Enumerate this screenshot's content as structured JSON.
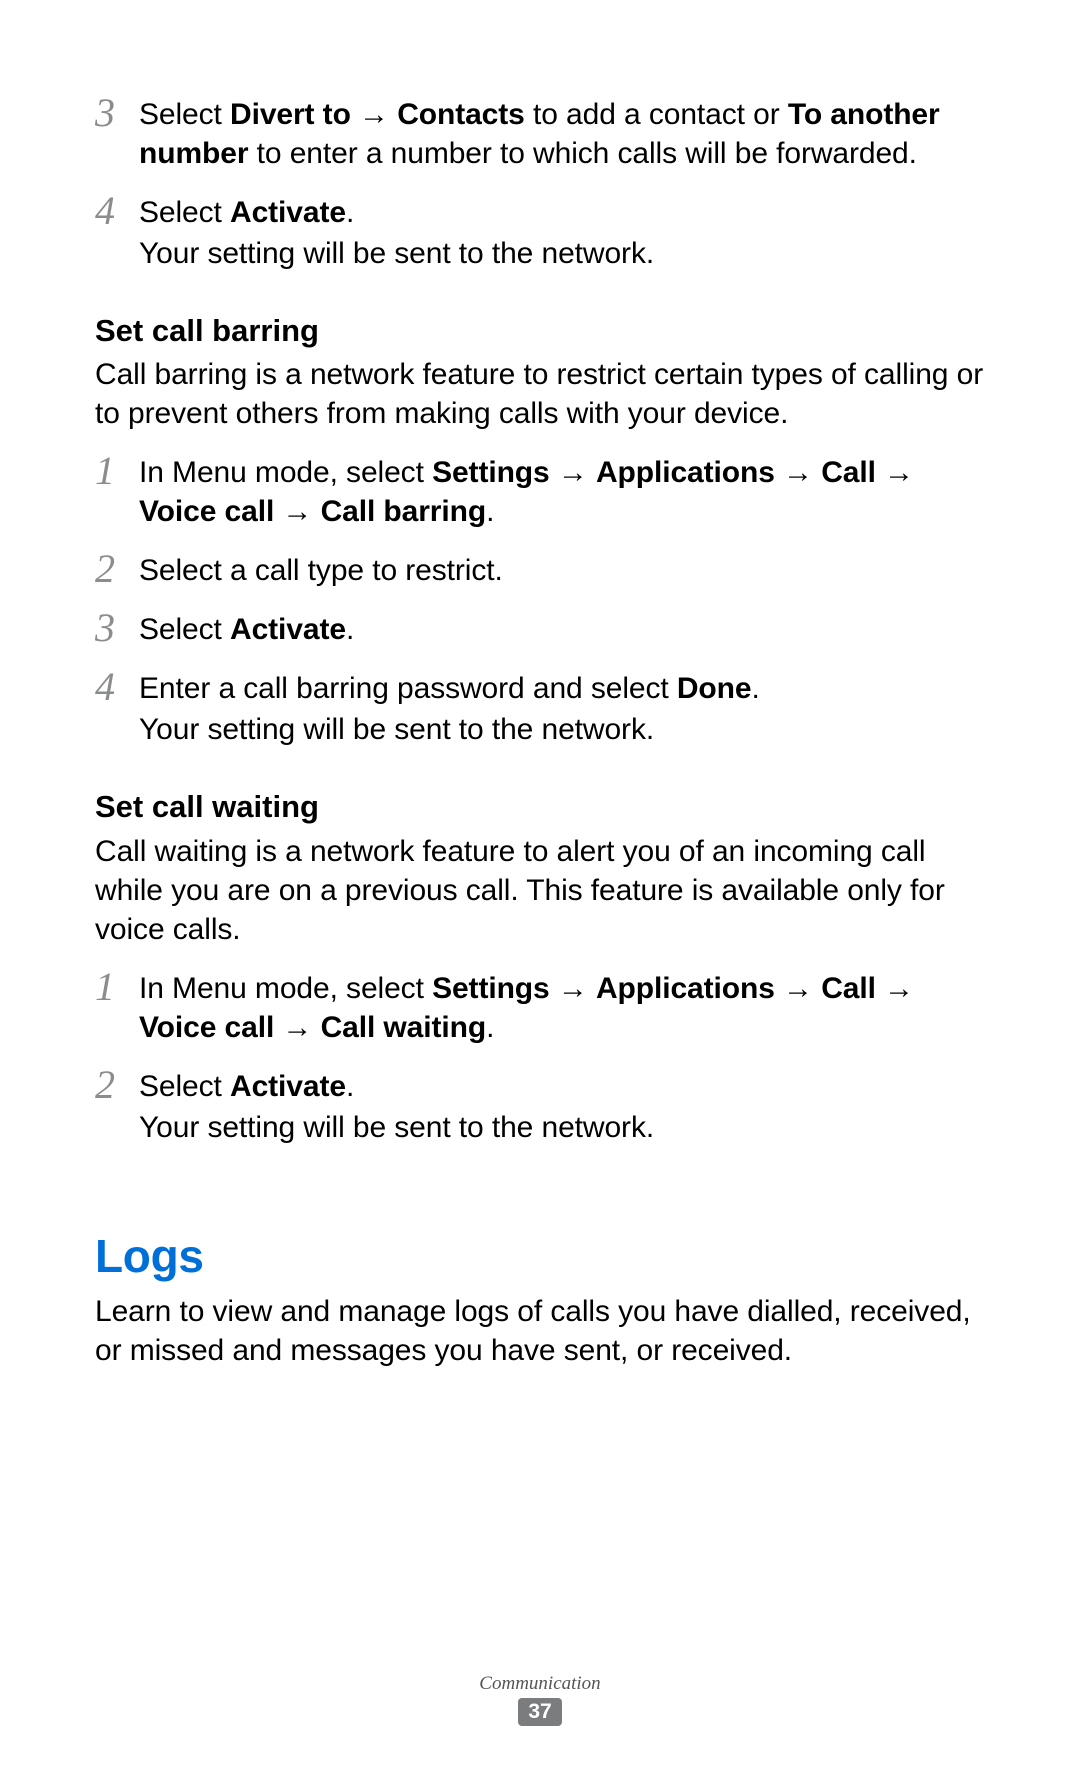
{
  "steps_top": [
    {
      "num": "3",
      "lines": [
        "Select <b>Divert to</b> → <b>Contacts</b> to add a contact or <b>To another number</b> to enter a number to which calls will be forwarded."
      ]
    },
    {
      "num": "4",
      "lines": [
        "Select <b>Activate</b>.",
        "Your setting will be sent to the network."
      ]
    }
  ],
  "section_barring": {
    "heading": "Set call barring",
    "intro": "Call barring is a network feature to restrict certain types of calling or to prevent others from making calls with your device.",
    "steps": [
      {
        "num": "1",
        "lines": [
          "In Menu mode, select <b>Settings</b> → <b>Applications</b> → <b>Call</b> → <b>Voice call</b> → <b>Call barring</b>."
        ]
      },
      {
        "num": "2",
        "lines": [
          "Select a call type to restrict."
        ]
      },
      {
        "num": "3",
        "lines": [
          "Select <b>Activate</b>."
        ]
      },
      {
        "num": "4",
        "lines": [
          "Enter a call barring password and select <b>Done</b>.",
          "Your setting will be sent to the network."
        ]
      }
    ]
  },
  "section_waiting": {
    "heading": "Set call waiting",
    "intro": "Call waiting is a network feature to alert you of an incoming call while you are on a previous call. This feature is available only for voice calls.",
    "steps": [
      {
        "num": "1",
        "lines": [
          "In Menu mode, select <b>Settings</b> → <b>Applications</b> → <b>Call</b> → <b>Voice call</b> → <b>Call waiting</b>."
        ]
      },
      {
        "num": "2",
        "lines": [
          "Select <b>Activate</b>.",
          "Your setting will be sent to the network."
        ]
      }
    ]
  },
  "section_logs": {
    "title": "Logs",
    "intro": "Learn to view and manage logs of calls you have dialled, received, or missed and messages you have sent, or received."
  },
  "footer": {
    "chapter": "Communication",
    "page": "37"
  }
}
